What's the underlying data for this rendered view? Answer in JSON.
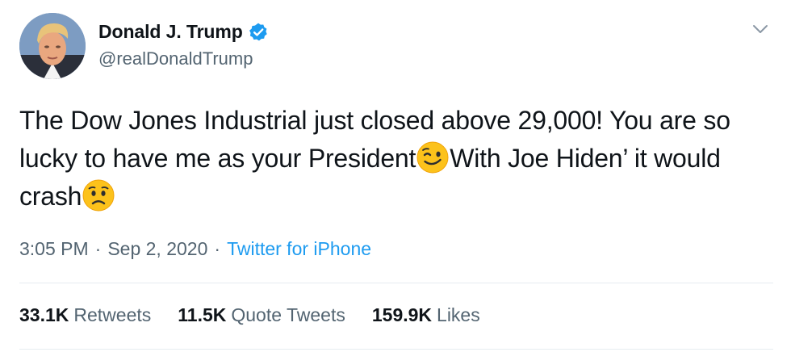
{
  "tweet": {
    "display_name": "Donald J. Trump",
    "handle": "@realDonaldTrump",
    "verified": true,
    "text": {
      "part1": "The Dow Jones Industrial just closed above 29,000! You are so lucky to have me as your President",
      "emoji1": "winking-face",
      "part2": "With Joe Hiden’ it would crash",
      "emoji2": "worried-face"
    },
    "time": "3:05 PM",
    "date": "Sep 2, 2020",
    "source": "Twitter for iPhone",
    "separator": "·"
  },
  "stats": {
    "retweets_count": "33.1K",
    "retweets_label": "Retweets",
    "quote_count": "11.5K",
    "quote_label": "Quote Tweets",
    "likes_count": "159.9K",
    "likes_label": "Likes"
  },
  "colors": {
    "text": "#0f1419",
    "secondary": "#536471",
    "link": "#1d9bf0",
    "verified": "#1d9bf0",
    "divider": "#e6ecf0"
  }
}
